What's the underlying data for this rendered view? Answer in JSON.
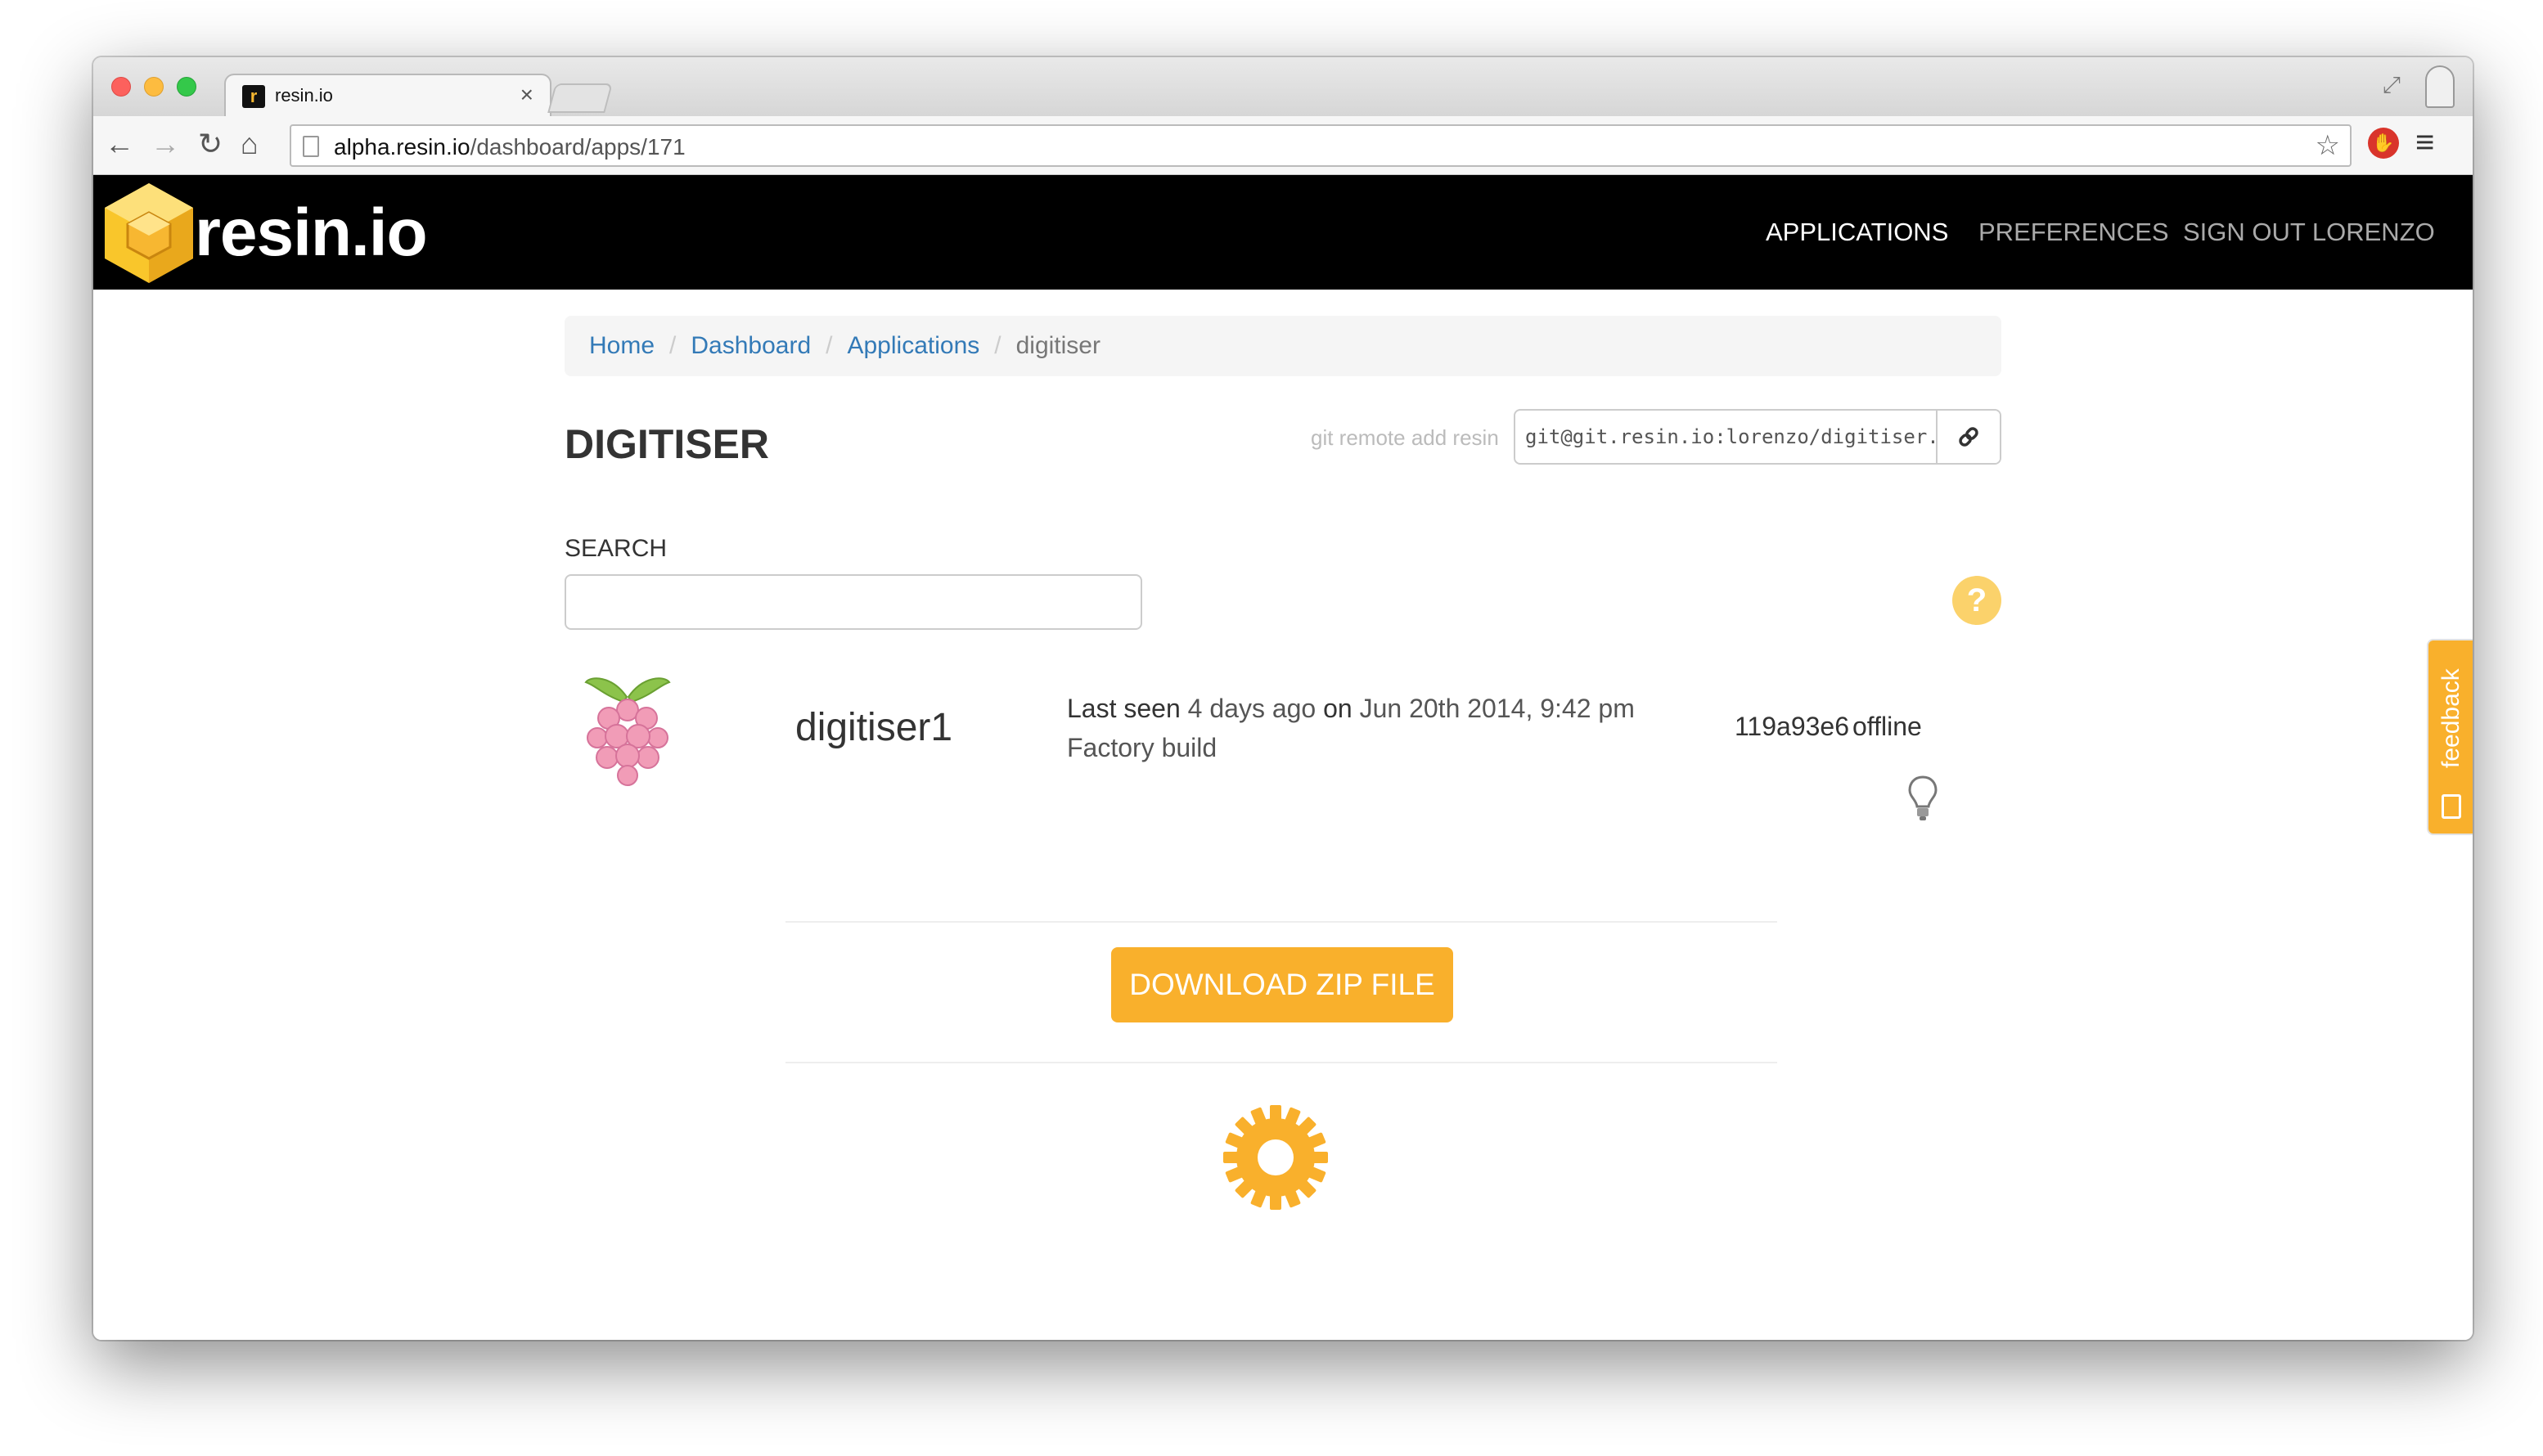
{
  "browser": {
    "tab_title": "resin.io",
    "tab_favicon": "r",
    "tab_close": "×",
    "url_host": "alpha.resin.io",
    "url_path": "/dashboard/apps/171",
    "icons": {
      "back": "back-arrow-icon",
      "forward": "forward-arrow-icon",
      "reload": "reload-icon",
      "home": "home-icon",
      "star": "bookmark-star-icon",
      "menu": "hamburger-menu-icon"
    }
  },
  "navbar": {
    "logo_text": "resin.io",
    "links": {
      "applications": "APPLICATIONS",
      "preferences": "PREFERENCES",
      "signout": "SIGN OUT LORENZO"
    }
  },
  "breadcrumb": {
    "home": "Home",
    "dashboard": "Dashboard",
    "applications": "Applications",
    "current": "digitiser",
    "separator": "/"
  },
  "app": {
    "title": "DIGITISER",
    "git_label": "git remote add resin",
    "git_remote": "git@git.resin.io:lorenzo/digitiser.git"
  },
  "search": {
    "label": "SEARCH",
    "value": "",
    "placeholder": ""
  },
  "help": {
    "glyph": "?"
  },
  "device": {
    "name": "digitiser1",
    "last_seen_label": "Last seen",
    "last_seen_relative": "4 days ago",
    "on_label": "on",
    "last_seen_date": "Jun 20th 2014, 9:42 pm",
    "build": "Factory build",
    "commit": "119a93e6",
    "status": "offline"
  },
  "actions": {
    "download": "DOWNLOAD ZIP FILE"
  },
  "feedback": {
    "label": "feedback"
  },
  "colors": {
    "accent": "#f9b02c",
    "navbar_bg": "#000000",
    "link": "#337ab7"
  }
}
